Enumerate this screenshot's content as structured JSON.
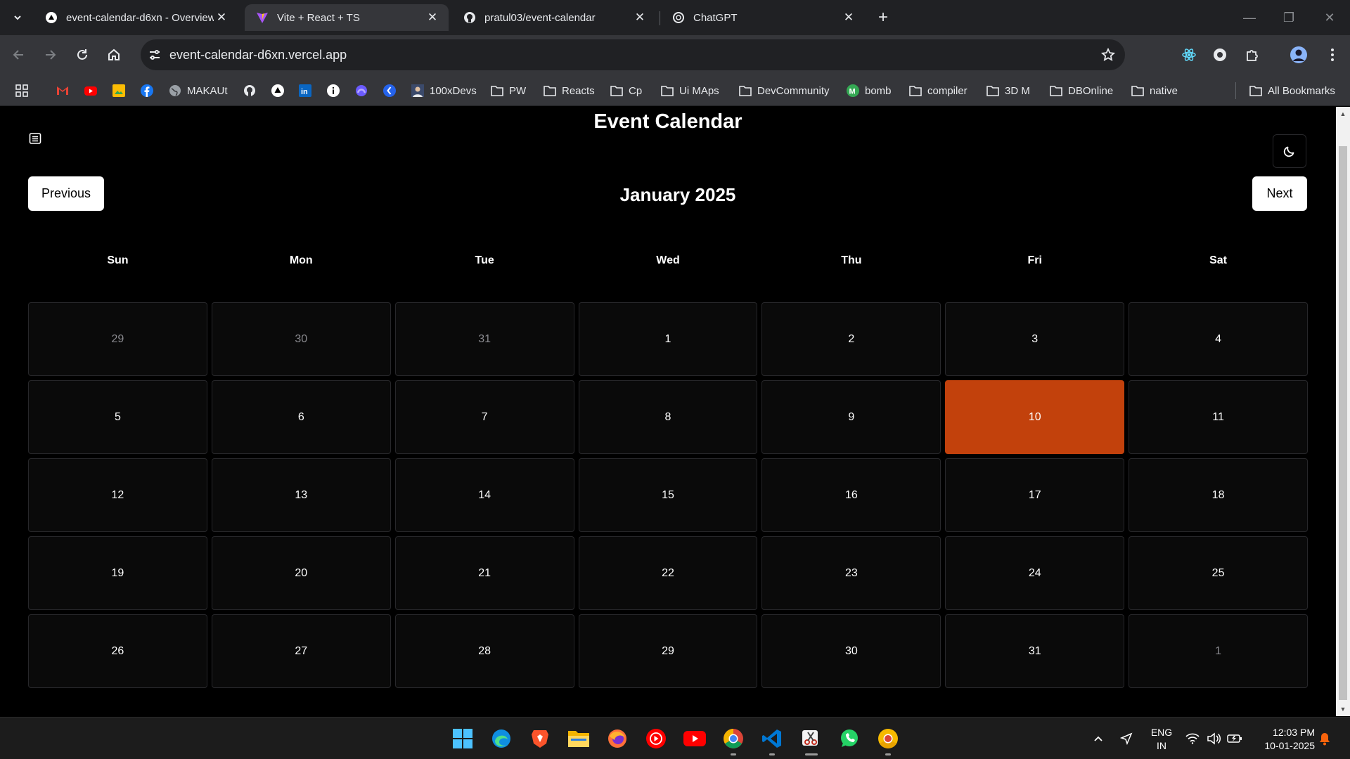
{
  "browser": {
    "tabs": [
      {
        "title": "event-calendar-d6xn - Overview",
        "icon": "vercel-icon",
        "active": false
      },
      {
        "title": "Vite + React + TS",
        "icon": "vite-icon",
        "active": true
      },
      {
        "title": "pratul03/event-calendar",
        "icon": "github-icon",
        "active": false
      },
      {
        "title": "ChatGPT",
        "icon": "chatgpt-icon",
        "active": false
      }
    ],
    "url": "event-calendar-d6xn.vercel.app",
    "bookmarks": [
      {
        "label": "",
        "icon": "gmail-icon"
      },
      {
        "label": "",
        "icon": "youtube-icon"
      },
      {
        "label": "",
        "icon": "photos-icon"
      },
      {
        "label": "",
        "icon": "facebook-icon"
      },
      {
        "label": "MAKAUt",
        "icon": "globe-icon"
      },
      {
        "label": "",
        "icon": "github-icon"
      },
      {
        "label": "",
        "icon": "vercel-icon"
      },
      {
        "label": "",
        "icon": "linkedin-icon"
      },
      {
        "label": "",
        "icon": "info-icon"
      },
      {
        "label": "",
        "icon": "arc-icon"
      },
      {
        "label": "",
        "icon": "k-icon"
      },
      {
        "label": "100xDevs",
        "icon": "avatar-icon"
      },
      {
        "label": "PW",
        "icon": "folder-icon"
      },
      {
        "label": "Reacts",
        "icon": "folder-icon"
      },
      {
        "label": "Cp",
        "icon": "folder-icon"
      },
      {
        "label": "Ui MAps",
        "icon": "folder-icon"
      },
      {
        "label": "DevCommunity",
        "icon": "folder-icon"
      },
      {
        "label": "bomb",
        "icon": "m-icon"
      },
      {
        "label": "compiler",
        "icon": "folder-icon"
      },
      {
        "label": "3D M",
        "icon": "folder-icon"
      },
      {
        "label": "DBOnline",
        "icon": "folder-icon"
      },
      {
        "label": "native",
        "icon": "folder-icon"
      }
    ],
    "all_bookmarks": "All Bookmarks"
  },
  "app": {
    "title": "Event Calendar",
    "month_label": "January 2025",
    "prev_label": "Previous",
    "next_label": "Next",
    "weekdays": [
      "Sun",
      "Mon",
      "Tue",
      "Wed",
      "Thu",
      "Fri",
      "Sat"
    ],
    "today": 10,
    "days": [
      {
        "n": "29",
        "outside": true
      },
      {
        "n": "30",
        "outside": true
      },
      {
        "n": "31",
        "outside": true
      },
      {
        "n": "1"
      },
      {
        "n": "2"
      },
      {
        "n": "3"
      },
      {
        "n": "4"
      },
      {
        "n": "5"
      },
      {
        "n": "6"
      },
      {
        "n": "7"
      },
      {
        "n": "8"
      },
      {
        "n": "9"
      },
      {
        "n": "10",
        "today": true
      },
      {
        "n": "11"
      },
      {
        "n": "12"
      },
      {
        "n": "13"
      },
      {
        "n": "14"
      },
      {
        "n": "15"
      },
      {
        "n": "16"
      },
      {
        "n": "17"
      },
      {
        "n": "18"
      },
      {
        "n": "19"
      },
      {
        "n": "20"
      },
      {
        "n": "21"
      },
      {
        "n": "22"
      },
      {
        "n": "23"
      },
      {
        "n": "24"
      },
      {
        "n": "25"
      },
      {
        "n": "26"
      },
      {
        "n": "27"
      },
      {
        "n": "28"
      },
      {
        "n": "29"
      },
      {
        "n": "30"
      },
      {
        "n": "31"
      },
      {
        "n": "1",
        "outside": true
      }
    ],
    "colors": {
      "today_bg": "#c2410c",
      "cell_border": "#27272a"
    }
  },
  "taskbar": {
    "apps": [
      "windows-start-icon",
      "edge-icon",
      "brave-icon",
      "file-explorer-icon",
      "firefox-icon",
      "youtube-music-icon",
      "youtube-icon",
      "chrome-icon",
      "vscode-icon",
      "snipping-tool-icon",
      "whatsapp-icon",
      "chrome-canary-icon"
    ],
    "lang_top": "ENG",
    "lang_bottom": "IN",
    "time": "12:03 PM",
    "date": "10-01-2025"
  }
}
